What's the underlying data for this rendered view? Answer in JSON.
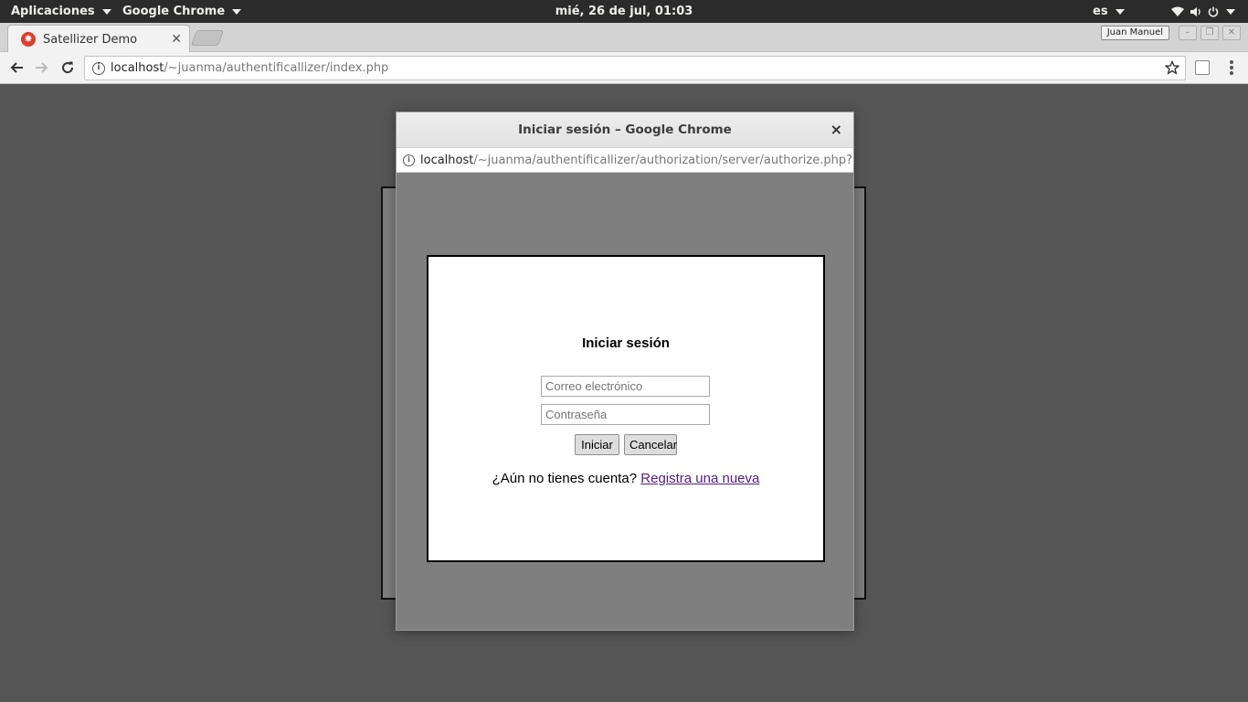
{
  "topbar": {
    "apps_menu": "Aplicaciones",
    "app_name": "Google Chrome",
    "clock": "mié, 26 de jul, 01:03",
    "language": "es",
    "icons": [
      "wifi-icon",
      "volume-icon",
      "power-icon"
    ]
  },
  "browser": {
    "tab": {
      "title": "Satellizer Demo"
    },
    "profile_name": "Juan Manuel",
    "address": {
      "host": "localhost",
      "path": "/~juanma/authentificallizer/index.php"
    }
  },
  "popup": {
    "title": "Iniciar sesión – Google Chrome",
    "close_label": "×",
    "address": {
      "host": "localhost",
      "path": "/~juanma/authentificallizer/authorization/server/authorize.php?resp"
    }
  },
  "login": {
    "heading": "Iniciar sesión",
    "email_placeholder": "Correo electrónico",
    "password_placeholder": "Contraseña",
    "submit_label": "Iniciar",
    "cancel_label": "Cancelar",
    "signup_prompt": "¿Aún no tienes cuenta?",
    "signup_link": "Registra una nueva"
  },
  "colors": {
    "desktop_bg": "#555555",
    "popup_bg": "#7f7f7f",
    "link": "#551a8b",
    "favicon": "#e03b2b"
  }
}
